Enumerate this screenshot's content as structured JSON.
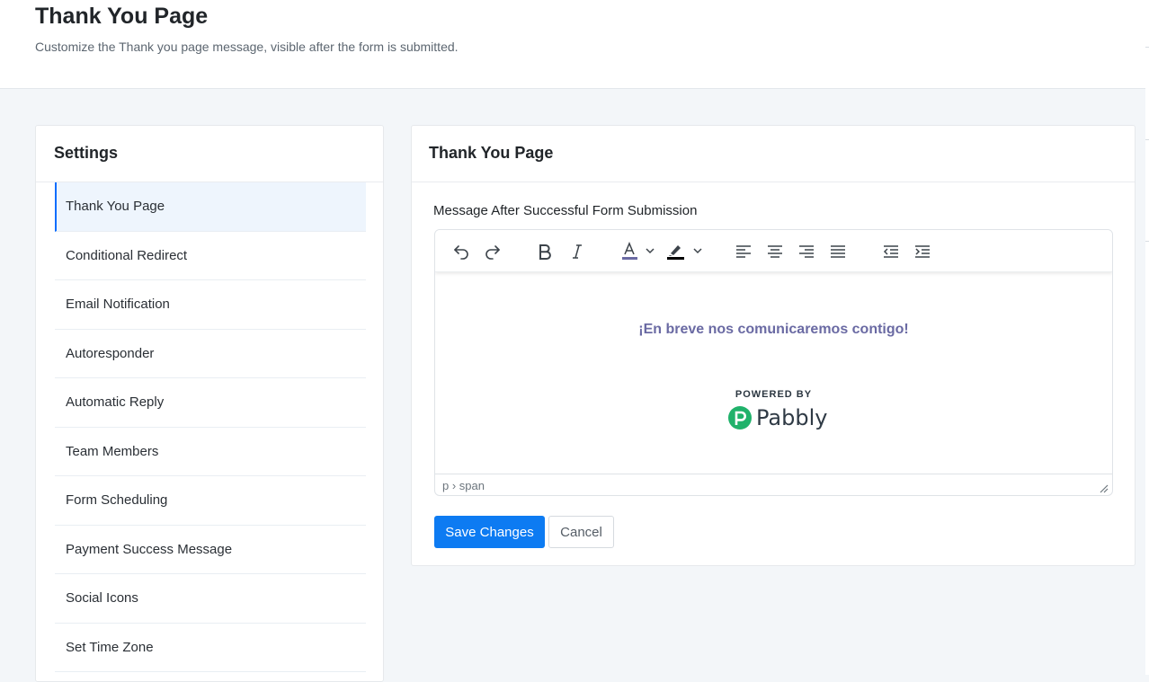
{
  "header": {
    "title": "Thank You Page",
    "subtitle": "Customize the Thank you page message, visible after the form is submitted."
  },
  "settings": {
    "title": "Settings",
    "active_item": "Thank You Page",
    "items": [
      {
        "label": "Thank You Page"
      },
      {
        "label": "Conditional Redirect"
      },
      {
        "label": "Email Notification"
      },
      {
        "label": "Autoresponder"
      },
      {
        "label": "Automatic Reply"
      },
      {
        "label": "Team Members"
      },
      {
        "label": "Form Scheduling"
      },
      {
        "label": "Payment Success Message"
      },
      {
        "label": "Social Icons"
      },
      {
        "label": "Set Time Zone"
      }
    ]
  },
  "editor_card": {
    "title": "Thank You Page",
    "field_label": "Message After Successful Form Submission",
    "message": "¡En breve nos comunicaremos contigo!",
    "powered_by": "POWERED BY",
    "brand": "Pabbly",
    "status_path": "p › span",
    "toolbar": [
      "undo-icon",
      "redo-icon",
      "bold-icon",
      "italic-icon",
      "font-color-icon",
      "highlight-color-icon",
      "align-left-icon",
      "align-center-icon",
      "align-right-icon",
      "align-justify-icon",
      "outdent-icon",
      "indent-icon"
    ]
  },
  "actions": {
    "save_label": "Save Changes",
    "cancel_label": "Cancel"
  },
  "colors": {
    "primary": "#0d7bf2",
    "message_text": "#6a6aa3",
    "brand_green": "#20b26b",
    "font_color_swatch": "#6a6aa3",
    "highlight_swatch": "#000000"
  }
}
